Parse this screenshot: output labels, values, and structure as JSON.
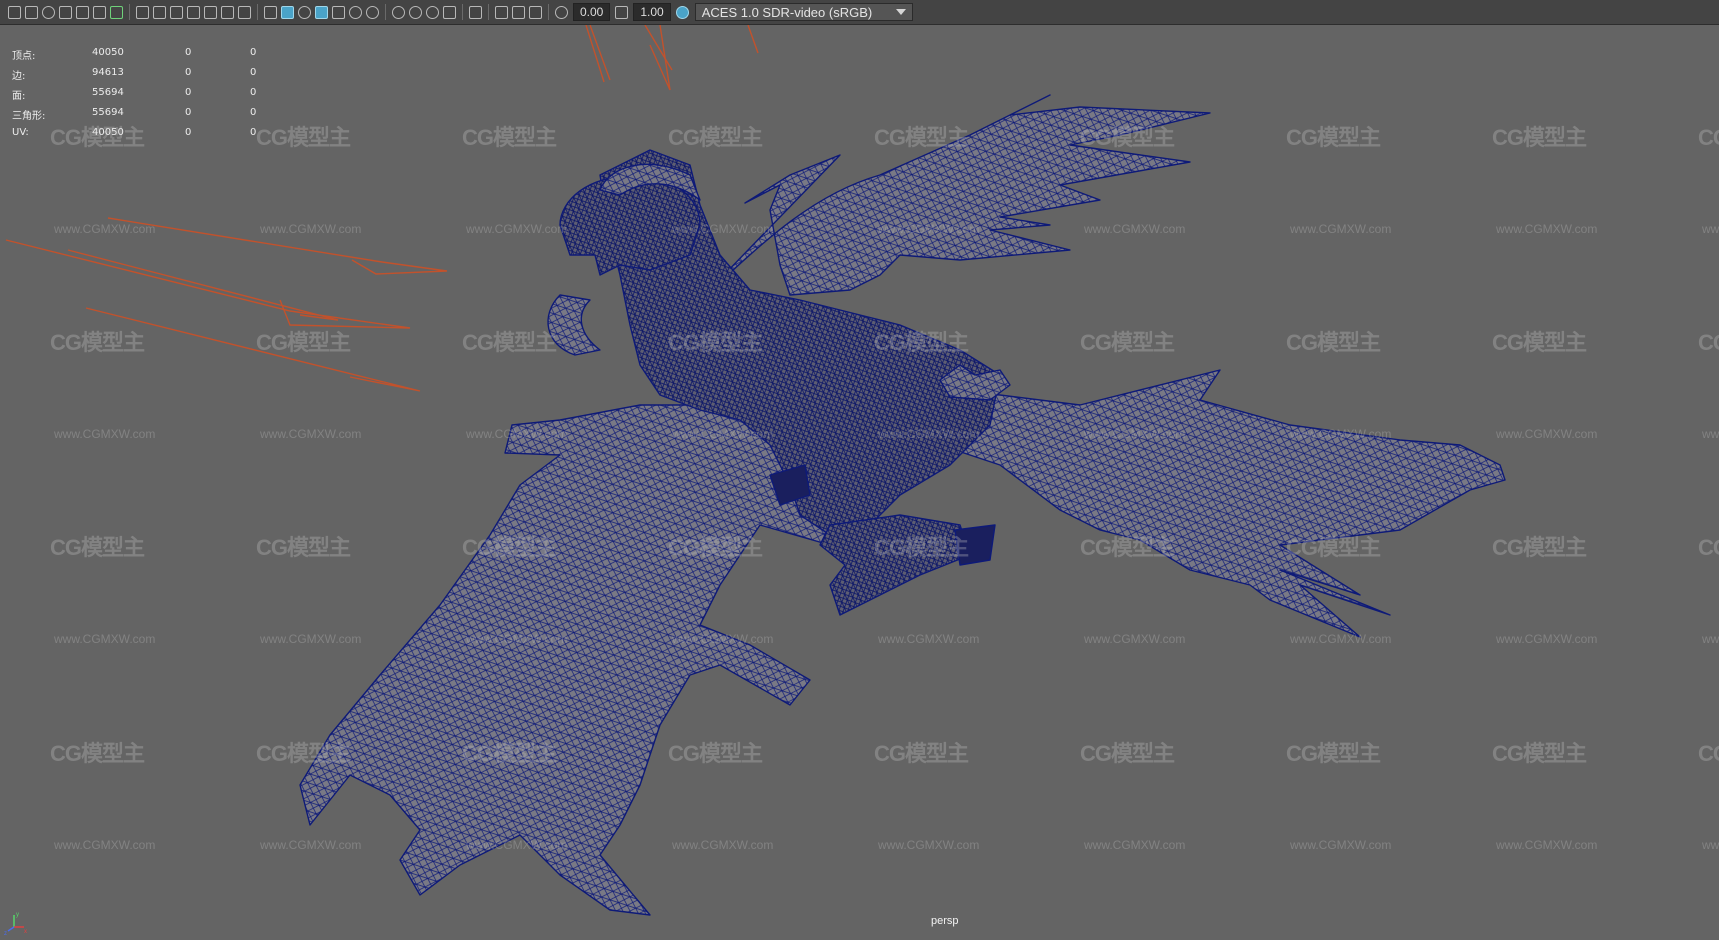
{
  "toolbar": {
    "icons_group1": [
      "camera-icon",
      "camera-attrs-icon",
      "bookmark-icon",
      "image-plane-icon",
      "grid-toggle-icon",
      "film-gate-icon"
    ],
    "icons_group2": [
      "grid-icon",
      "resolution-gate-icon",
      "gate-mask-icon",
      "field-chart-icon",
      "safe-action-icon",
      "safe-title-icon"
    ],
    "icons_group3": [
      "wireframe-icon",
      "smooth-shade-icon",
      "wireframe-on-shaded-icon",
      "textured-icon",
      "use-all-lights-icon",
      "shadows-icon"
    ],
    "exposure_value": "0.00",
    "gamma_value": "1.00",
    "color_space": "ACES 1.0 SDR-video (sRGB)"
  },
  "hud": {
    "rows": [
      {
        "label": "顶点:",
        "total": "40050",
        "selected": "0",
        "component": "0"
      },
      {
        "label": "边:",
        "total": "94613",
        "selected": "0",
        "component": "0"
      },
      {
        "label": "面:",
        "total": "55694",
        "selected": "0",
        "component": "0"
      },
      {
        "label": "三角形:",
        "total": "55694",
        "selected": "0",
        "component": "0"
      },
      {
        "label": "UV:",
        "total": "40050",
        "selected": "0",
        "component": "0"
      }
    ]
  },
  "viewport": {
    "camera_label": "persp",
    "axis_labels": {
      "x": "x",
      "y": "y",
      "z": "z"
    },
    "model": "dragon wireframe mesh",
    "wireframe_color": "#0e1a78",
    "background_color": "#646464",
    "curve_color": "#c2522c"
  },
  "watermark": {
    "logo_text": "CG模型主",
    "url_text": "www.CGMXW.com"
  }
}
